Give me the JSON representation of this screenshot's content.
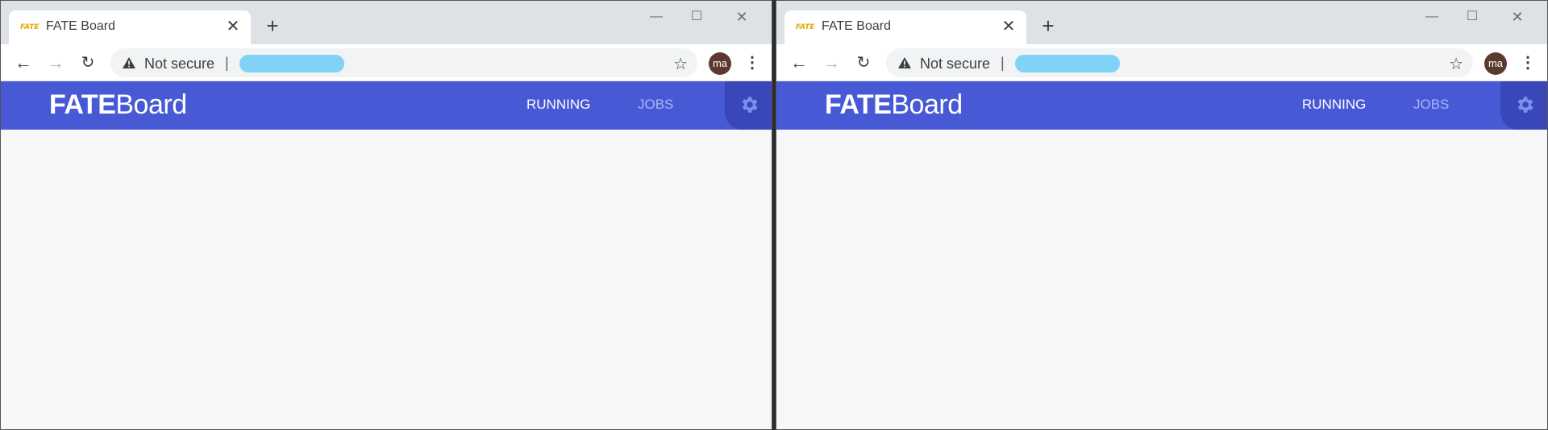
{
  "windows": [
    {
      "tab": {
        "title": "FATE Board",
        "favicon": "FATE"
      },
      "toolbar": {
        "security_label": "Not secure",
        "separator": "|",
        "avatar": "ma"
      },
      "app": {
        "logo_strong": "FATE",
        "logo_rest": "Board",
        "nav_running": "RUNNING",
        "nav_jobs": "JOBS"
      }
    },
    {
      "tab": {
        "title": "FATE Board",
        "favicon": "FATE"
      },
      "toolbar": {
        "security_label": "Not secure",
        "separator": "|",
        "avatar": "ma"
      },
      "app": {
        "logo_strong": "FATE",
        "logo_rest": "Board",
        "nav_running": "RUNNING",
        "nav_jobs": "JOBS"
      }
    }
  ],
  "colors": {
    "header": "#4759d5",
    "header_dark": "#3a47b8",
    "redaction": "#7fd3f7",
    "avatar": "#5b3a2e"
  },
  "icons": [
    "close-icon",
    "plus-icon",
    "back-arrow-icon",
    "forward-arrow-icon",
    "reload-icon",
    "warning-icon",
    "star-icon",
    "kebab-menu-icon",
    "gear-icon"
  ]
}
